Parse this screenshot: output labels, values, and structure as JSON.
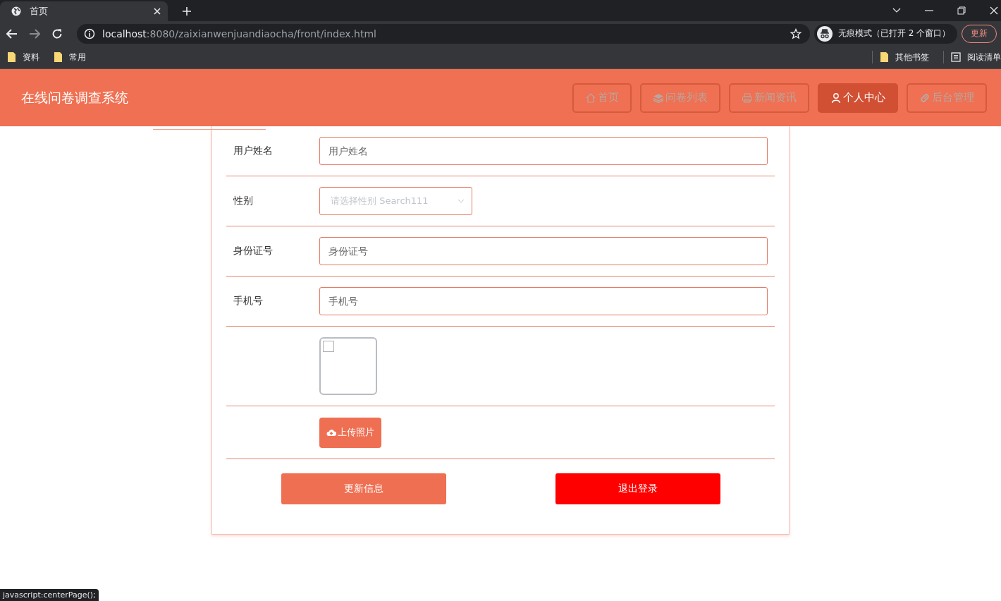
{
  "browser": {
    "tab": {
      "title": "首页",
      "selected": true
    },
    "url": {
      "host": "localhost",
      "path": ":8080/zaixianwenjuandiaocha/front/index.html"
    },
    "incognito": "无痕模式（已打开 2 个窗口）",
    "update_button": "更新",
    "bookmarks_left": [
      "资料",
      "常用"
    ],
    "bookmarks_right": [
      {
        "label": "其他书签",
        "kind": "folder"
      },
      {
        "label": "阅读清单",
        "kind": "list"
      }
    ]
  },
  "header": {
    "title": "在线问卷调查系统",
    "nav": [
      {
        "label": "首页",
        "kind": "home",
        "selected": false
      },
      {
        "label": "问卷列表",
        "kind": "layers",
        "selected": false
      },
      {
        "label": "新闻资讯",
        "kind": "print",
        "selected": false
      },
      {
        "label": "个人中心",
        "kind": "user",
        "selected": true
      },
      {
        "label": "后台管理",
        "kind": "link",
        "selected": false
      }
    ]
  },
  "form": {
    "rows": [
      {
        "kind": "text",
        "label": "用户姓名",
        "placeholder": "用户姓名"
      },
      {
        "kind": "select",
        "label": "性别",
        "placeholder": "请选择性别 Search111"
      },
      {
        "kind": "text",
        "label": "身份证号",
        "placeholder": "身份证号"
      },
      {
        "kind": "text",
        "label": "手机号",
        "placeholder": "手机号"
      },
      {
        "kind": "image"
      },
      {
        "kind": "upload",
        "button": "上传照片"
      }
    ],
    "buttons": [
      {
        "label": "更新信息",
        "kind": "primary"
      },
      {
        "label": "退出登录",
        "kind": "danger"
      }
    ]
  },
  "status_bar": "javascript:centerPage();"
}
